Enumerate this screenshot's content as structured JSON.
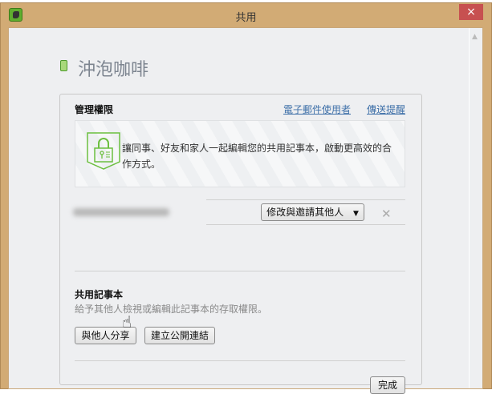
{
  "window": {
    "title": "共用",
    "close_label": "×"
  },
  "notebook": {
    "title": "沖泡咖啡"
  },
  "permissions": {
    "heading": "管理權限",
    "email_users_link": "電子郵件使用者",
    "send_reminder_link": "傳送提醒",
    "promo_text": "讓同事、好友和家人一起編輯您的共用記事本，啟動更高效的合作方式。",
    "member_permission_dropdown": "修改與邀請其他人",
    "remove_label": "✕"
  },
  "shared_notebook": {
    "heading": "共用記事本",
    "description": "給予其他人檢視或編輯此記事本的存取權限。",
    "share_button": "與他人分享",
    "public_link_button": "建立公開連結"
  },
  "footer": {
    "done_button": "完成"
  },
  "colors": {
    "titlebar": "#d2ab75",
    "close": "#c75050",
    "link": "#3d6fa8",
    "accent_green": "#5fae2e"
  }
}
